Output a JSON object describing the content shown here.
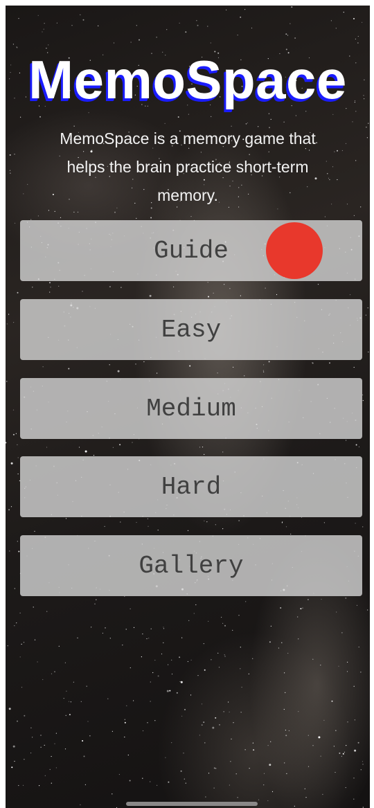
{
  "app": {
    "title": "MemoSpace",
    "description": "MemoSpace is a memory game that helps the brain practice short-term memory."
  },
  "menu": {
    "guide_label": "Guide",
    "easy_label": "Easy",
    "medium_label": "Medium",
    "hard_label": "Hard",
    "gallery_label": "Gallery"
  },
  "colors": {
    "title_shadow": "#1a1cff",
    "button_bg": "#d6d6d6",
    "button_text": "#404040",
    "record_dot": "#e8382c"
  },
  "icons": {
    "record_indicator": "red-circle-icon"
  }
}
